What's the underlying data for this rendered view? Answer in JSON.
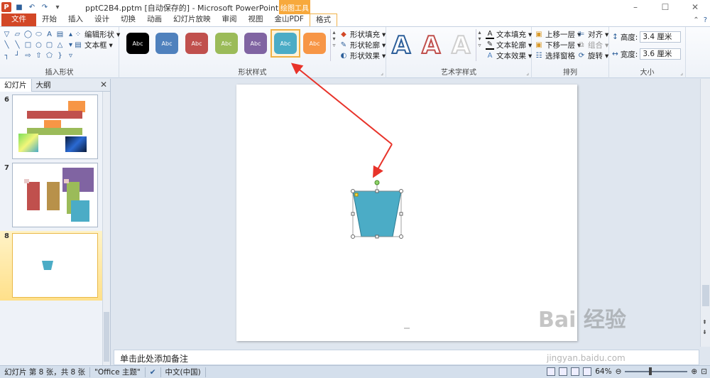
{
  "window": {
    "title": "pptC2B4.pptm [自动保存的] - Microsoft PowerPoint",
    "context_tab_title": "绘图工具",
    "app_icon": "P"
  },
  "tabs": [
    "文件",
    "开始",
    "插入",
    "设计",
    "切换",
    "动画",
    "幻灯片放映",
    "审阅",
    "视图",
    "金山PDF",
    "格式"
  ],
  "ribbon": {
    "insert_shapes": {
      "label": "插入形状",
      "edit_shape": "编辑形状",
      "textbox": "文本框"
    },
    "shape_styles": {
      "label": "形状样式",
      "swatch_text": "Abc",
      "swatches": [
        "#000000",
        "#4f81bd",
        "#c0504d",
        "#9bbb59",
        "#8064a2",
        "#4bacc6",
        "#f79646"
      ],
      "fill": "形状填充",
      "outline": "形状轮廓",
      "effects": "形状效果"
    },
    "wordart": {
      "label": "艺术字样式",
      "letter": "A",
      "text_fill": "文本填充",
      "text_outline": "文本轮廓",
      "text_effects": "文本效果"
    },
    "arrange": {
      "label": "排列",
      "bring_forward": "上移一层",
      "send_backward": "下移一层",
      "selection_pane": "选择窗格",
      "align": "对齐",
      "group": "组合",
      "rotate": "旋转"
    },
    "size": {
      "label": "大小",
      "height_label": "高度:",
      "height_value": "3.4 厘米",
      "width_label": "宽度:",
      "width_value": "3.6 厘米"
    }
  },
  "panel": {
    "tabs": [
      "幻灯片",
      "大纲"
    ],
    "slides": [
      "6",
      "7",
      "8"
    ]
  },
  "notes_placeholder": "单击此处添加备注",
  "status": {
    "slide_info": "幻灯片 第 8 张，共 8 张",
    "theme": "\"Office 主题\"",
    "language": "中文(中国)",
    "zoom": "64%"
  },
  "shape": {
    "fill": "#4bacc6"
  },
  "watermark": {
    "main": "Bai 经验",
    "sub": "jingyan.baidu.com"
  }
}
